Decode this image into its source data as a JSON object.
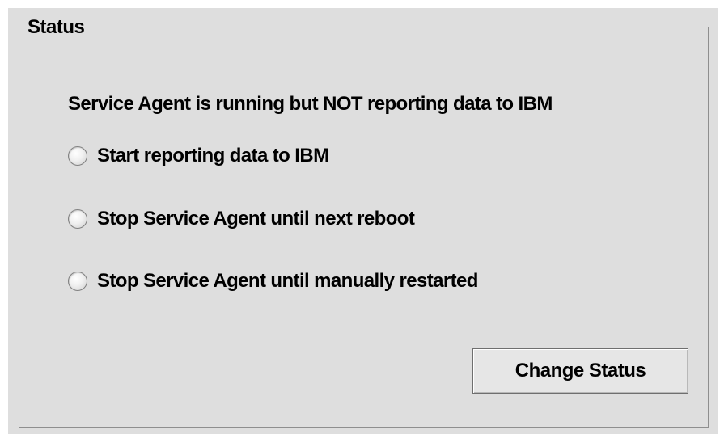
{
  "group": {
    "title": "Status"
  },
  "status_message": "Service Agent is running but NOT reporting data to IBM",
  "options": [
    {
      "label": "Start reporting data to IBM",
      "selected": false
    },
    {
      "label": "Stop Service Agent until next reboot",
      "selected": false
    },
    {
      "label": "Stop Service Agent until manually restarted",
      "selected": false
    }
  ],
  "actions": {
    "change_status_label": "Change Status"
  },
  "colors": {
    "panel_background": "#dedede",
    "border": "#8e8e8e",
    "text": "#000000"
  }
}
